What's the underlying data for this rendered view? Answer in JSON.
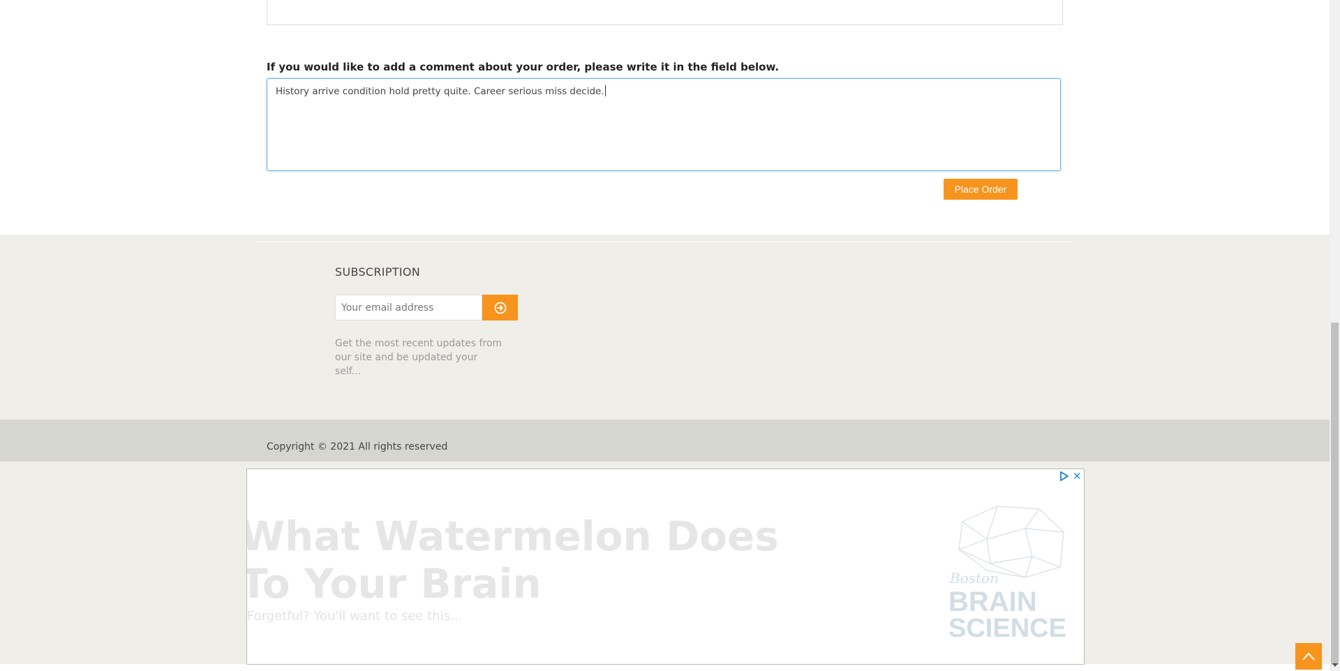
{
  "order": {
    "comment_label": "If you would like to add a comment about your order, please write it in the field below.",
    "comment_value": "History arrive condition hold pretty quite. Career serious miss decide.",
    "place_order_label": "Place Order"
  },
  "footer": {
    "subscription_title": "SUBSCRIPTION",
    "email_placeholder": "Your email address",
    "subscribe_icon": "arrow-circle-right-icon",
    "description": "Get the most recent updates from our site and be updated your self...",
    "copyright": "Copyright © 2021 All rights reserved"
  },
  "ad": {
    "headline_line1": "What Watermelon Does",
    "headline_line2": "To Your Brain",
    "subtext": "Forgetful? You'll want to see this...",
    "logo_line1": "Boston",
    "logo_line2": "BRAIN",
    "logo_line3": "SCIENCE",
    "adchoices_icon": "adchoices-icon",
    "close_icon": "close-icon"
  },
  "back_to_top_icon": "chevron-up-icon",
  "colors": {
    "accent": "#f7941d",
    "focus_border": "#66afe9",
    "footer_bg": "#efeee8",
    "copyright_bg": "#d6d6d1"
  }
}
